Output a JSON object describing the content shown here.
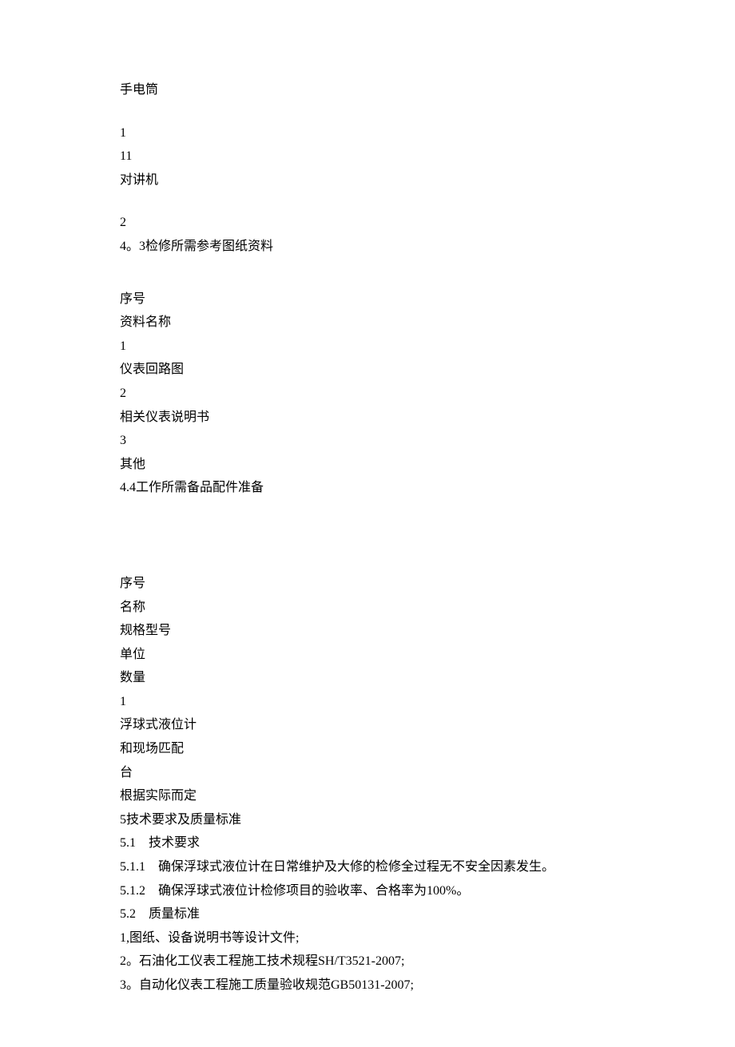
{
  "lines": {
    "l1": "手电筒",
    "l2": "1",
    "l3": "11",
    "l4": "对讲机",
    "l5": "2",
    "l6": "4。3检修所需参考图纸资料",
    "l7": "序号",
    "l8": "资料名称",
    "l9": "1",
    "l10": "仪表回路图",
    "l11": "2",
    "l12": "相关仪表说明书",
    "l13": "3",
    "l14": "其他",
    "l15": "4.4工作所需备品配件准备",
    "l16": "序号",
    "l17": "名称",
    "l18": "规格型号",
    "l19": "单位",
    "l20": "数量",
    "l21": "1",
    "l22": "浮球式液位计",
    "l23": "和现场匹配",
    "l24": "台",
    "l25": "根据实际而定",
    "l26": "5技术要求及质量标准",
    "l27": "5.1　技术要求",
    "l28": "5.1.1　确保浮球式液位计在日常维护及大修的检修全过程无不安全因素发生。",
    "l29": "5.1.2　确保浮球式液位计检修项目的验收率、合格率为100%。",
    "l30": "5.2　质量标准",
    "l31": "1,图纸、设备说明书等设计文件;",
    "l32": "2。石油化工仪表工程施工技术规程SH/T3521-2007;",
    "l33": "3。自动化仪表工程施工质量验收规范GB50131-2007;"
  }
}
